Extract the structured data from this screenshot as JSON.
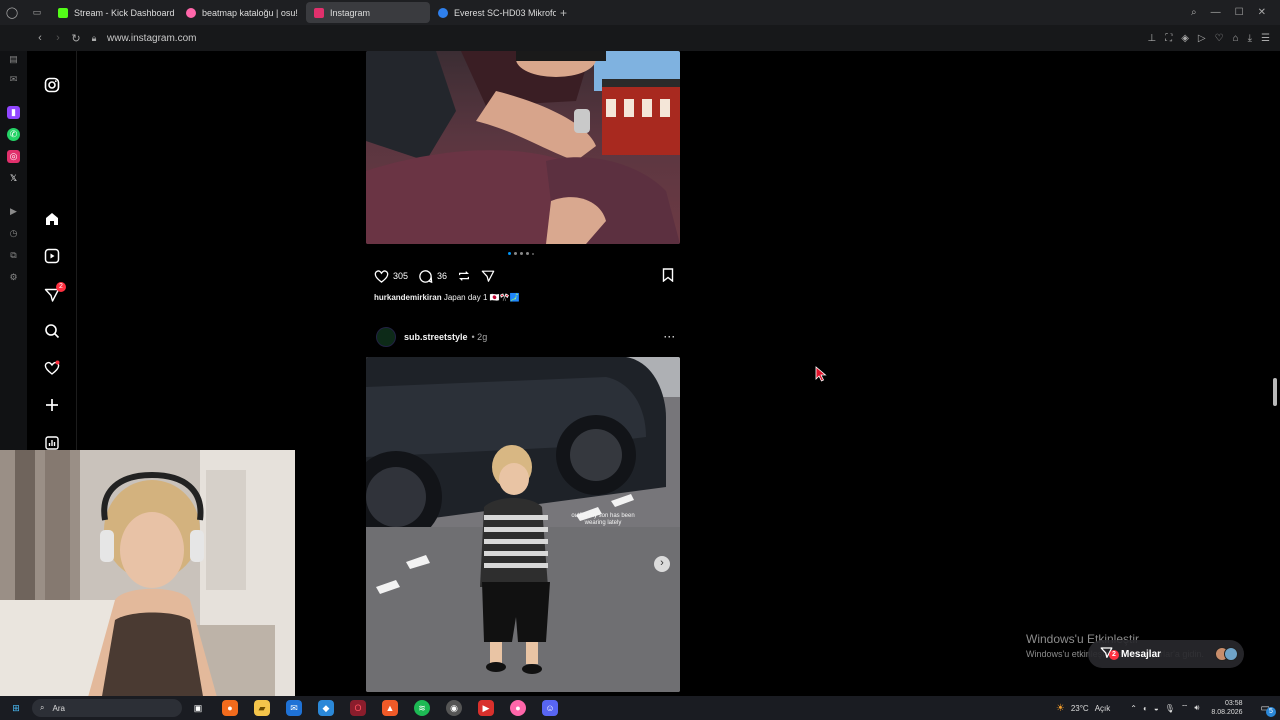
{
  "browser": {
    "tabs": [
      {
        "label": "Stream - Kick Dashboard",
        "color": "#53fc18"
      },
      {
        "label": "beatmap kataloğu | osu!",
        "color": "#ff66aa"
      },
      {
        "label": "Instagram",
        "color": "#e1306c"
      },
      {
        "label": "Everest SC-HD03 Mikrofon",
        "color": "#2f80ed"
      }
    ],
    "new_tab": "+",
    "url": "www.instagram.com"
  },
  "post1": {
    "likes": "305",
    "comments": "36",
    "caption_user": "hurkandemirkiran",
    "caption_text": "Japan day 1 🇯🇵🎌🗾"
  },
  "post2": {
    "username": "sub.streetstyle",
    "time": "• 2g",
    "overlay_text": "outfits my son has been wearing lately",
    "more": "···"
  },
  "sidebar": {
    "messages_badge": "2"
  },
  "watermark": {
    "title": "Windows'u Etkinleştir",
    "subtitle": "Windows'u etkinleştirmek için Ayarlar'a gidin."
  },
  "messages_pill": {
    "label": "Mesajlar",
    "badge": "2"
  },
  "taskbar": {
    "search": "Ara",
    "weather_temp": "23°C",
    "weather_desc": "Açık",
    "time": "03:58",
    "date": "8.08.2026",
    "notification_count": "5"
  },
  "colors": {
    "accent": "#0095f6",
    "badge": "#ff3040",
    "background": "#000000"
  }
}
